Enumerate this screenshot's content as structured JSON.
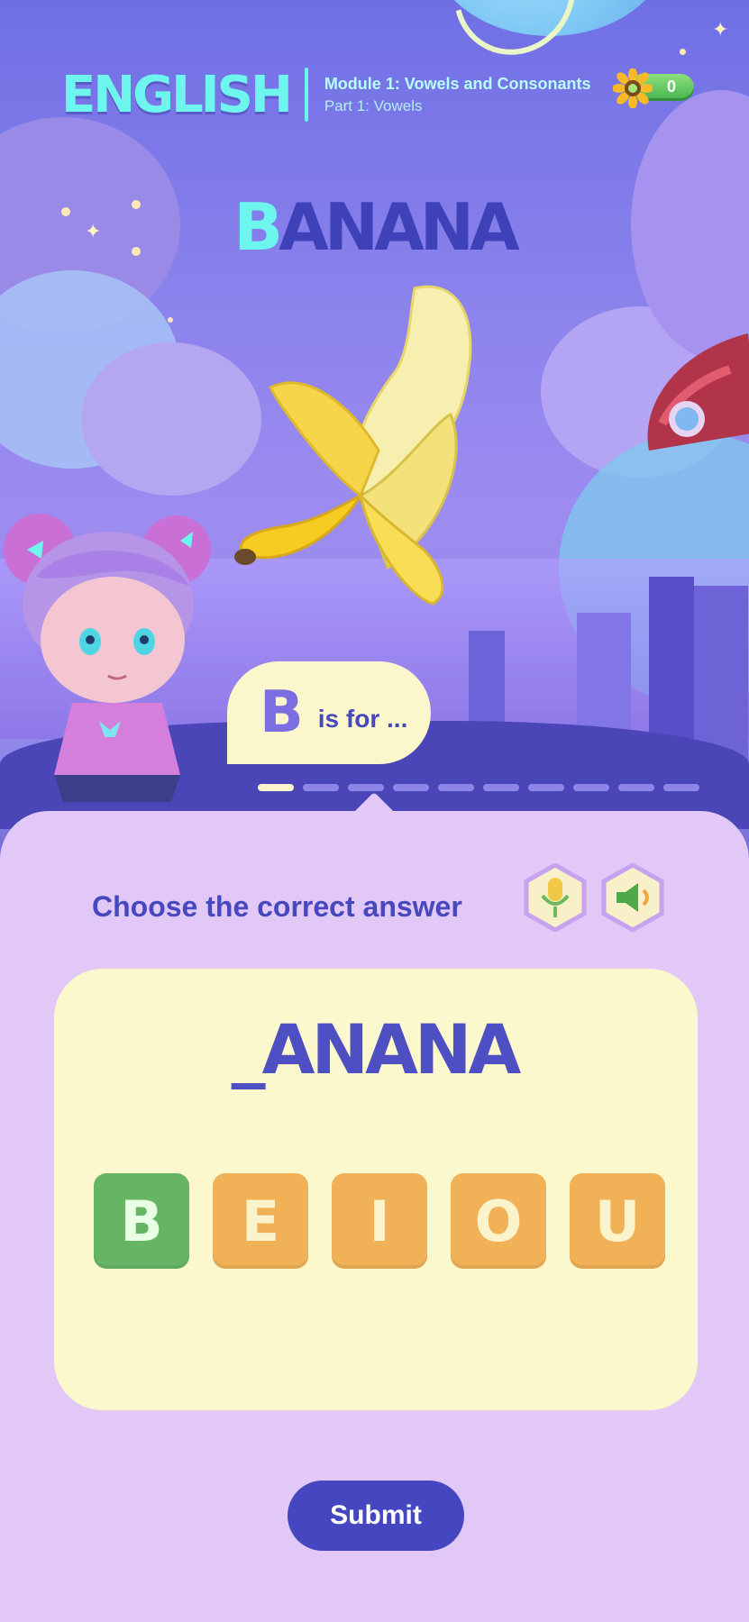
{
  "header": {
    "subject": "ENGLISH",
    "module": "Module 1: Vowels and Consonants",
    "part": "Part 1: Vowels",
    "coins": "0"
  },
  "word": {
    "first_letter": "B",
    "rest": "ANANA",
    "image": "banana"
  },
  "bubble": {
    "letter": "B",
    "text": "is for ..."
  },
  "progress": {
    "total_steps": 10,
    "current_step": 1
  },
  "quiz": {
    "instruction": "Choose the correct answer",
    "puzzle": "_ANANA",
    "choices": [
      "B",
      "E",
      "I",
      "O",
      "U"
    ],
    "selected": "B"
  },
  "actions": {
    "submit_label": "Submit"
  },
  "colors": {
    "accent": "#4547c0",
    "selected": "#66b565",
    "choice": "#f0b157",
    "highlight": "#6ef6ee"
  },
  "icons": [
    "sunflower-coin-icon",
    "microphone-icon",
    "speaker-icon"
  ]
}
